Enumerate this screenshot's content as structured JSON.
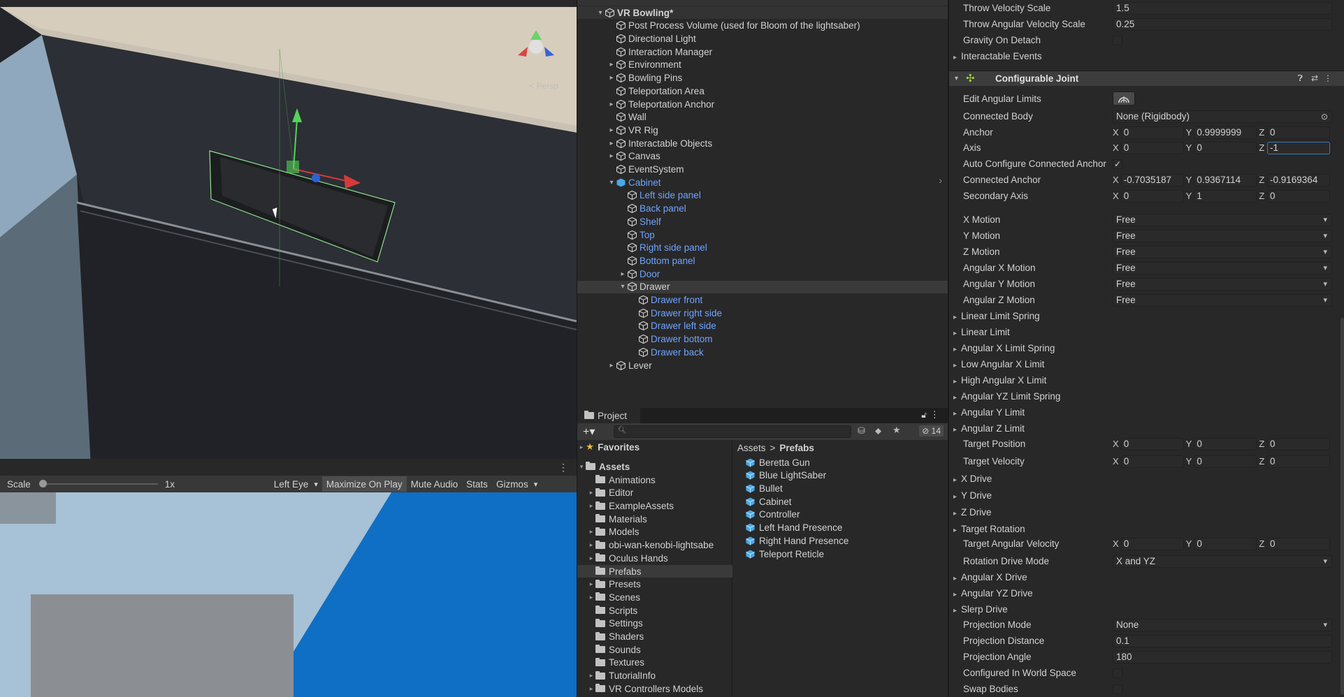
{
  "scene_view": {
    "gizmo_label": "< Persp"
  },
  "game_toolbar": {
    "scale_label": "Scale",
    "scale_value": "1x",
    "eye": "Left Eye",
    "maximize": "Maximize On Play",
    "mute": "Mute Audio",
    "stats": "Stats",
    "gizmos": "Gizmos"
  },
  "hierarchy": {
    "rows": [
      {
        "label": "VR Bowling*",
        "depth": 0,
        "kind": "scene",
        "arrow": "▾"
      },
      {
        "label": "Post Process Volume (used for Bloom of the lightsaber)",
        "depth": 1,
        "kind": "go",
        "arrow": ""
      },
      {
        "label": "Directional Light",
        "depth": 1,
        "kind": "go",
        "arrow": ""
      },
      {
        "label": "Interaction Manager",
        "depth": 1,
        "kind": "go",
        "arrow": ""
      },
      {
        "label": "Environment",
        "depth": 1,
        "kind": "go",
        "arrow": "▸"
      },
      {
        "label": "Bowling Pins",
        "depth": 1,
        "kind": "go",
        "arrow": "▸"
      },
      {
        "label": "Teleportation Area",
        "depth": 1,
        "kind": "go",
        "arrow": ""
      },
      {
        "label": "Teleportation Anchor",
        "depth": 1,
        "kind": "go",
        "arrow": "▸"
      },
      {
        "label": "Wall",
        "depth": 1,
        "kind": "go",
        "arrow": ""
      },
      {
        "label": "VR Rig",
        "depth": 1,
        "kind": "go",
        "arrow": "▸"
      },
      {
        "label": "Interactable Objects",
        "depth": 1,
        "kind": "go",
        "arrow": "▸"
      },
      {
        "label": "Canvas",
        "depth": 1,
        "kind": "go",
        "arrow": "▸"
      },
      {
        "label": "EventSystem",
        "depth": 1,
        "kind": "go",
        "arrow": ""
      },
      {
        "label": "Cabinet",
        "depth": 1,
        "kind": "prefab-root",
        "arrow": "▾"
      },
      {
        "label": "Left side panel",
        "depth": 2,
        "kind": "prefab",
        "arrow": ""
      },
      {
        "label": "Back panel",
        "depth": 2,
        "kind": "prefab",
        "arrow": ""
      },
      {
        "label": "Shelf",
        "depth": 2,
        "kind": "prefab",
        "arrow": ""
      },
      {
        "label": "Top",
        "depth": 2,
        "kind": "prefab",
        "arrow": ""
      },
      {
        "label": "Right side panel",
        "depth": 2,
        "kind": "prefab",
        "arrow": ""
      },
      {
        "label": "Bottom panel",
        "depth": 2,
        "kind": "prefab",
        "arrow": ""
      },
      {
        "label": "Door",
        "depth": 2,
        "kind": "prefab",
        "arrow": "▸"
      },
      {
        "label": "Drawer",
        "depth": 2,
        "kind": "selected",
        "arrow": "▾"
      },
      {
        "label": "Drawer front",
        "depth": 3,
        "kind": "prefab",
        "arrow": ""
      },
      {
        "label": "Drawer right side",
        "depth": 3,
        "kind": "prefab",
        "arrow": ""
      },
      {
        "label": "Drawer left side",
        "depth": 3,
        "kind": "prefab",
        "arrow": ""
      },
      {
        "label": "Drawer bottom",
        "depth": 3,
        "kind": "prefab",
        "arrow": ""
      },
      {
        "label": "Drawer back",
        "depth": 3,
        "kind": "prefab",
        "arrow": ""
      },
      {
        "label": "Lever",
        "depth": 1,
        "kind": "go",
        "arrow": "▸"
      }
    ]
  },
  "project": {
    "tab_label": "Project",
    "hidden_count": "14",
    "breadcrumb": {
      "root": "Assets",
      "separator": ">",
      "current": "Prefabs"
    },
    "favorites_label": "Favorites",
    "assets_label": "Assets",
    "folders": [
      {
        "label": "Animations",
        "arrow": ""
      },
      {
        "label": "Editor",
        "arrow": "▸"
      },
      {
        "label": "ExampleAssets",
        "arrow": "▸"
      },
      {
        "label": "Materials",
        "arrow": ""
      },
      {
        "label": "Models",
        "arrow": "▸"
      },
      {
        "label": "obi-wan-kenobi-lightsabe",
        "arrow": "▸"
      },
      {
        "label": "Oculus Hands",
        "arrow": "▸"
      },
      {
        "label": "Prefabs",
        "arrow": "",
        "selected": true
      },
      {
        "label": "Presets",
        "arrow": "▸"
      },
      {
        "label": "Scenes",
        "arrow": "▸"
      },
      {
        "label": "Scripts",
        "arrow": ""
      },
      {
        "label": "Settings",
        "arrow": ""
      },
      {
        "label": "Shaders",
        "arrow": ""
      },
      {
        "label": "Sounds",
        "arrow": ""
      },
      {
        "label": "Textures",
        "arrow": ""
      },
      {
        "label": "TutorialInfo",
        "arrow": "▸"
      },
      {
        "label": "VR Controllers Models",
        "arrow": "▸"
      }
    ],
    "prefabs": [
      "Beretta Gun",
      "Blue LightSaber",
      "Bullet",
      "Cabinet",
      "Controller",
      "Left Hand Presence",
      "Right Hand Presence",
      "Teleport Reticle"
    ]
  },
  "inspector": {
    "throw_velocity_scale": {
      "label": "Throw Velocity Scale",
      "value": "1.5"
    },
    "throw_angular_velocity_scale": {
      "label": "Throw Angular Velocity Scale",
      "value": "0.25"
    },
    "gravity_on_detach": {
      "label": "Gravity On Detach"
    },
    "interactable_events": "Interactable Events",
    "component_title": "Configurable Joint",
    "edit_angular_limits": "Edit Angular Limits",
    "connected_body": {
      "label": "Connected Body",
      "value": "None (Rigidbody)"
    },
    "anchor": {
      "label": "Anchor",
      "x": "0",
      "y": "0.9999999",
      "z": "0"
    },
    "axis": {
      "label": "Axis",
      "x": "0",
      "y": "0",
      "z": "-1"
    },
    "auto_configure": {
      "label": "Auto Configure Connected Anchor",
      "checked": "✓"
    },
    "connected_anchor": {
      "label": "Connected Anchor",
      "x": "-0.7035187",
      "y": "0.9367114",
      "z": "-0.9169364"
    },
    "secondary_axis": {
      "label": "Secondary Axis",
      "x": "0",
      "y": "1",
      "z": "0"
    },
    "x_motion": {
      "label": "X Motion",
      "value": "Free"
    },
    "y_motion": {
      "label": "Y Motion",
      "value": "Free"
    },
    "z_motion": {
      "label": "Z Motion",
      "value": "Free"
    },
    "angular_x_motion": {
      "label": "Angular X Motion",
      "value": "Free"
    },
    "angular_y_motion": {
      "label": "Angular Y Motion",
      "value": "Free"
    },
    "angular_z_motion": {
      "label": "Angular Z Motion",
      "value": "Free"
    },
    "foldouts_a": [
      "Linear Limit Spring",
      "Linear Limit",
      "Angular X Limit Spring",
      "Low Angular X Limit",
      "High Angular X Limit",
      "Angular YZ Limit Spring",
      "Angular Y Limit",
      "Angular Z Limit"
    ],
    "target_position": {
      "label": "Target Position",
      "x": "0",
      "y": "0",
      "z": "0"
    },
    "target_velocity": {
      "label": "Target Velocity",
      "x": "0",
      "y": "0",
      "z": "0"
    },
    "foldouts_b": [
      "X Drive",
      "Y Drive",
      "Z Drive",
      "Target Rotation"
    ],
    "target_angular_velocity": {
      "label": "Target Angular Velocity",
      "x": "0",
      "y": "0",
      "z": "0"
    },
    "rotation_drive_mode": {
      "label": "Rotation Drive Mode",
      "value": "X and YZ"
    },
    "foldouts_c": [
      "Angular X Drive",
      "Angular YZ Drive",
      "Slerp Drive"
    ],
    "projection_mode": {
      "label": "Projection Mode",
      "value": "None"
    },
    "projection_distance": {
      "label": "Projection Distance",
      "value": "0.1"
    },
    "projection_angle": {
      "label": "Projection Angle",
      "value": "180"
    },
    "configured_in_world_space": {
      "label": "Configured In World Space"
    },
    "swap_bodies": {
      "label": "Swap Bodies"
    }
  },
  "colors": {
    "prefab_blue": "#6fa3ff",
    "focus_blue": "#3a79bb",
    "game_sky": "#0f6fc4"
  }
}
